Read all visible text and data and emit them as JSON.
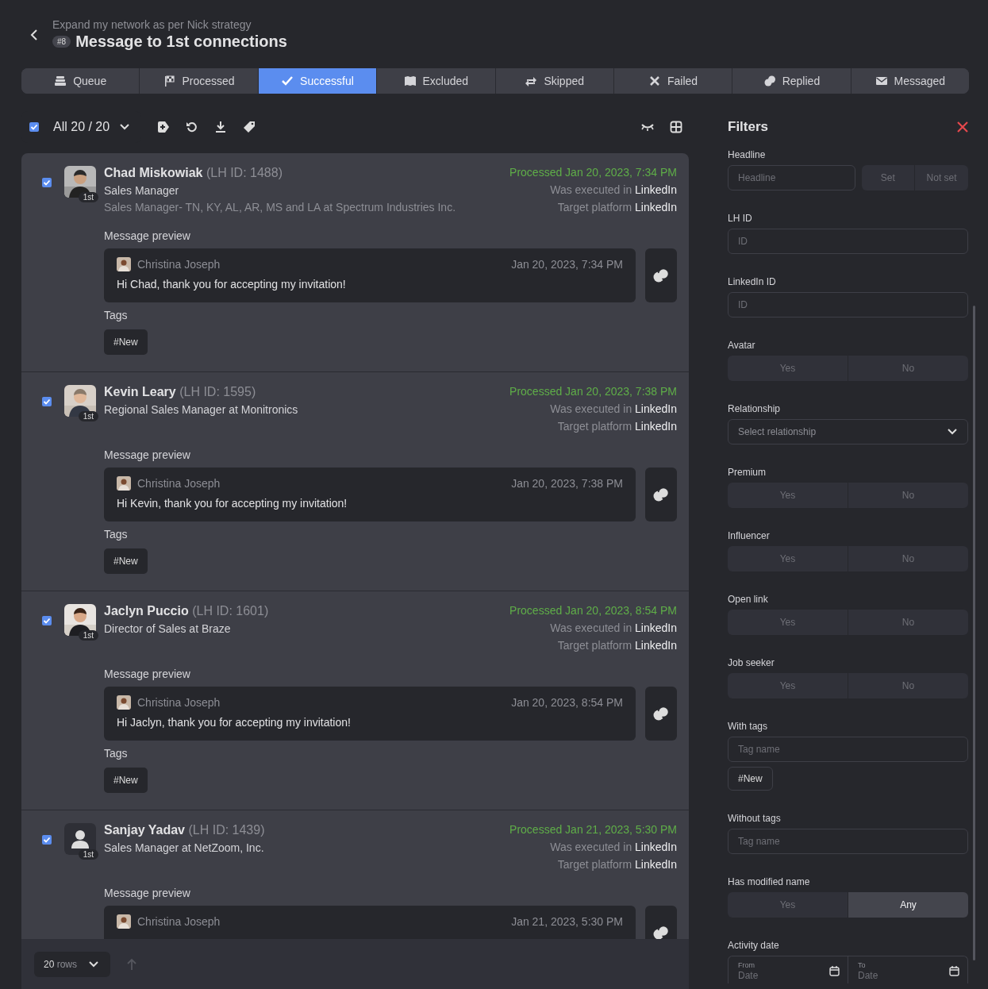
{
  "header": {
    "subtitle": "Expand my network as per Nick strategy",
    "badge": "#8",
    "title": "Message to 1st connections"
  },
  "tabs": [
    {
      "label": "Queue",
      "selected": false
    },
    {
      "label": "Processed",
      "selected": false
    },
    {
      "label": "Successful",
      "selected": true
    },
    {
      "label": "Excluded",
      "selected": false
    },
    {
      "label": "Skipped",
      "selected": false
    },
    {
      "label": "Failed",
      "selected": false
    },
    {
      "label": "Replied",
      "selected": false
    },
    {
      "label": "Messaged",
      "selected": false
    }
  ],
  "toolbar": {
    "select_all": {
      "checked": true,
      "label": "All 20 / 20"
    }
  },
  "contacts": [
    {
      "checked": true,
      "avatar": {
        "kind": "picture"
      },
      "degree": "1st",
      "name": "Chad Miskowiak",
      "lh_id": "(LH ID: 1488)",
      "headline": "Sales Manager",
      "subline": "Sales Manager- TN, KY, AL, AR, MS and LA at Spectrum Industries Inc.",
      "processed": "Processed Jan 20, 2023, 7:34 PM",
      "executed_label": "Was executed in",
      "executed_value": "LinkedIn",
      "target_label": "Target platform",
      "target_value": "LinkedIn",
      "preview_label": "Message preview",
      "message": {
        "sender": "Christina Joseph",
        "time": "Jan 20, 2023, 7:34 PM",
        "text": "Hi Chad, thank you for accepting my invitation!"
      },
      "tags_label": "Tags",
      "tags": [
        "#New"
      ]
    },
    {
      "checked": true,
      "avatar": {
        "kind": "picture"
      },
      "degree": "1st",
      "name": "Kevin Leary",
      "lh_id": "(LH ID: 1595)",
      "headline": "Regional Sales Manager at Monitronics",
      "processed": "Processed Jan 20, 2023, 7:38 PM",
      "executed_label": "Was executed in",
      "executed_value": "LinkedIn",
      "target_label": "Target platform",
      "target_value": "LinkedIn",
      "preview_label": "Message preview",
      "message": {
        "sender": "Christina Joseph",
        "time": "Jan 20, 2023, 7:38 PM",
        "text": "Hi Kevin, thank you for accepting my invitation!"
      },
      "tags_label": "Tags",
      "tags": [
        "#New"
      ]
    },
    {
      "checked": true,
      "avatar": {
        "kind": "picture"
      },
      "degree": "1st",
      "name": "Jaclyn Puccio",
      "lh_id": "(LH ID: 1601)",
      "headline": "Director of Sales at Braze",
      "processed": "Processed Jan 20, 2023, 8:54 PM",
      "executed_label": "Was executed in",
      "executed_value": "LinkedIn",
      "target_label": "Target platform",
      "target_value": "LinkedIn",
      "preview_label": "Message preview",
      "message": {
        "sender": "Christina Joseph",
        "time": "Jan 20, 2023, 8:54 PM",
        "text": "Hi Jaclyn, thank you for accepting my invitation!"
      },
      "tags_label": "Tags",
      "tags": [
        "#New"
      ]
    },
    {
      "checked": true,
      "avatar": {
        "kind": "placeholder"
      },
      "degree": "1st",
      "name": "Sanjay Yadav",
      "lh_id": "(LH ID: 1439)",
      "headline": "Sales Manager at NetZoom, Inc.",
      "processed": "Processed Jan 21, 2023, 5:30 PM",
      "executed_label": "Was executed in",
      "executed_value": "LinkedIn",
      "target_label": "Target platform",
      "target_value": "LinkedIn",
      "preview_label": "Message preview",
      "message": {
        "sender": "Christina Joseph",
        "time": "Jan 21, 2023, 5:30 PM"
      }
    }
  ],
  "footer": {
    "rows_value": "20",
    "rows_unit": "rows"
  },
  "filters": {
    "title": "Filters",
    "sections": [
      {
        "kind": "input_toggle",
        "label": "Headline",
        "placeholder": "Headline",
        "options": [
          {
            "label": "Set",
            "selected": false
          },
          {
            "label": "Not set",
            "selected": false
          }
        ]
      },
      {
        "kind": "input",
        "label": "LH ID",
        "placeholder": "ID"
      },
      {
        "kind": "input",
        "label": "LinkedIn ID",
        "placeholder": "ID"
      },
      {
        "kind": "toggle",
        "label": "Avatar",
        "options": [
          {
            "label": "Yes",
            "selected": false
          },
          {
            "label": "No",
            "selected": false
          }
        ]
      },
      {
        "kind": "select",
        "label": "Relationship",
        "placeholder": "Select relationship"
      },
      {
        "kind": "toggle",
        "label": "Premium",
        "options": [
          {
            "label": "Yes",
            "selected": false
          },
          {
            "label": "No",
            "selected": false
          }
        ]
      },
      {
        "kind": "toggle",
        "label": "Influencer",
        "options": [
          {
            "label": "Yes",
            "selected": false
          },
          {
            "label": "No",
            "selected": false
          }
        ]
      },
      {
        "kind": "toggle",
        "label": "Open link",
        "options": [
          {
            "label": "Yes",
            "selected": false
          },
          {
            "label": "No",
            "selected": false
          }
        ]
      },
      {
        "kind": "toggle",
        "label": "Job seeker",
        "options": [
          {
            "label": "Yes",
            "selected": false
          },
          {
            "label": "No",
            "selected": false
          }
        ]
      },
      {
        "kind": "tags",
        "label": "With tags",
        "placeholder": "Tag name",
        "tags": [
          "#New"
        ]
      },
      {
        "kind": "input",
        "label": "Without tags",
        "placeholder": "Tag name"
      },
      {
        "kind": "toggle",
        "label": "Has modified name",
        "options": [
          {
            "label": "Yes",
            "selected": false
          },
          {
            "label": "Any",
            "selected": true
          }
        ]
      },
      {
        "kind": "dates",
        "label": "Activity date",
        "fields": [
          {
            "label": "From",
            "placeholder": "Date"
          },
          {
            "label": "To",
            "placeholder": "Date"
          }
        ]
      }
    ]
  }
}
